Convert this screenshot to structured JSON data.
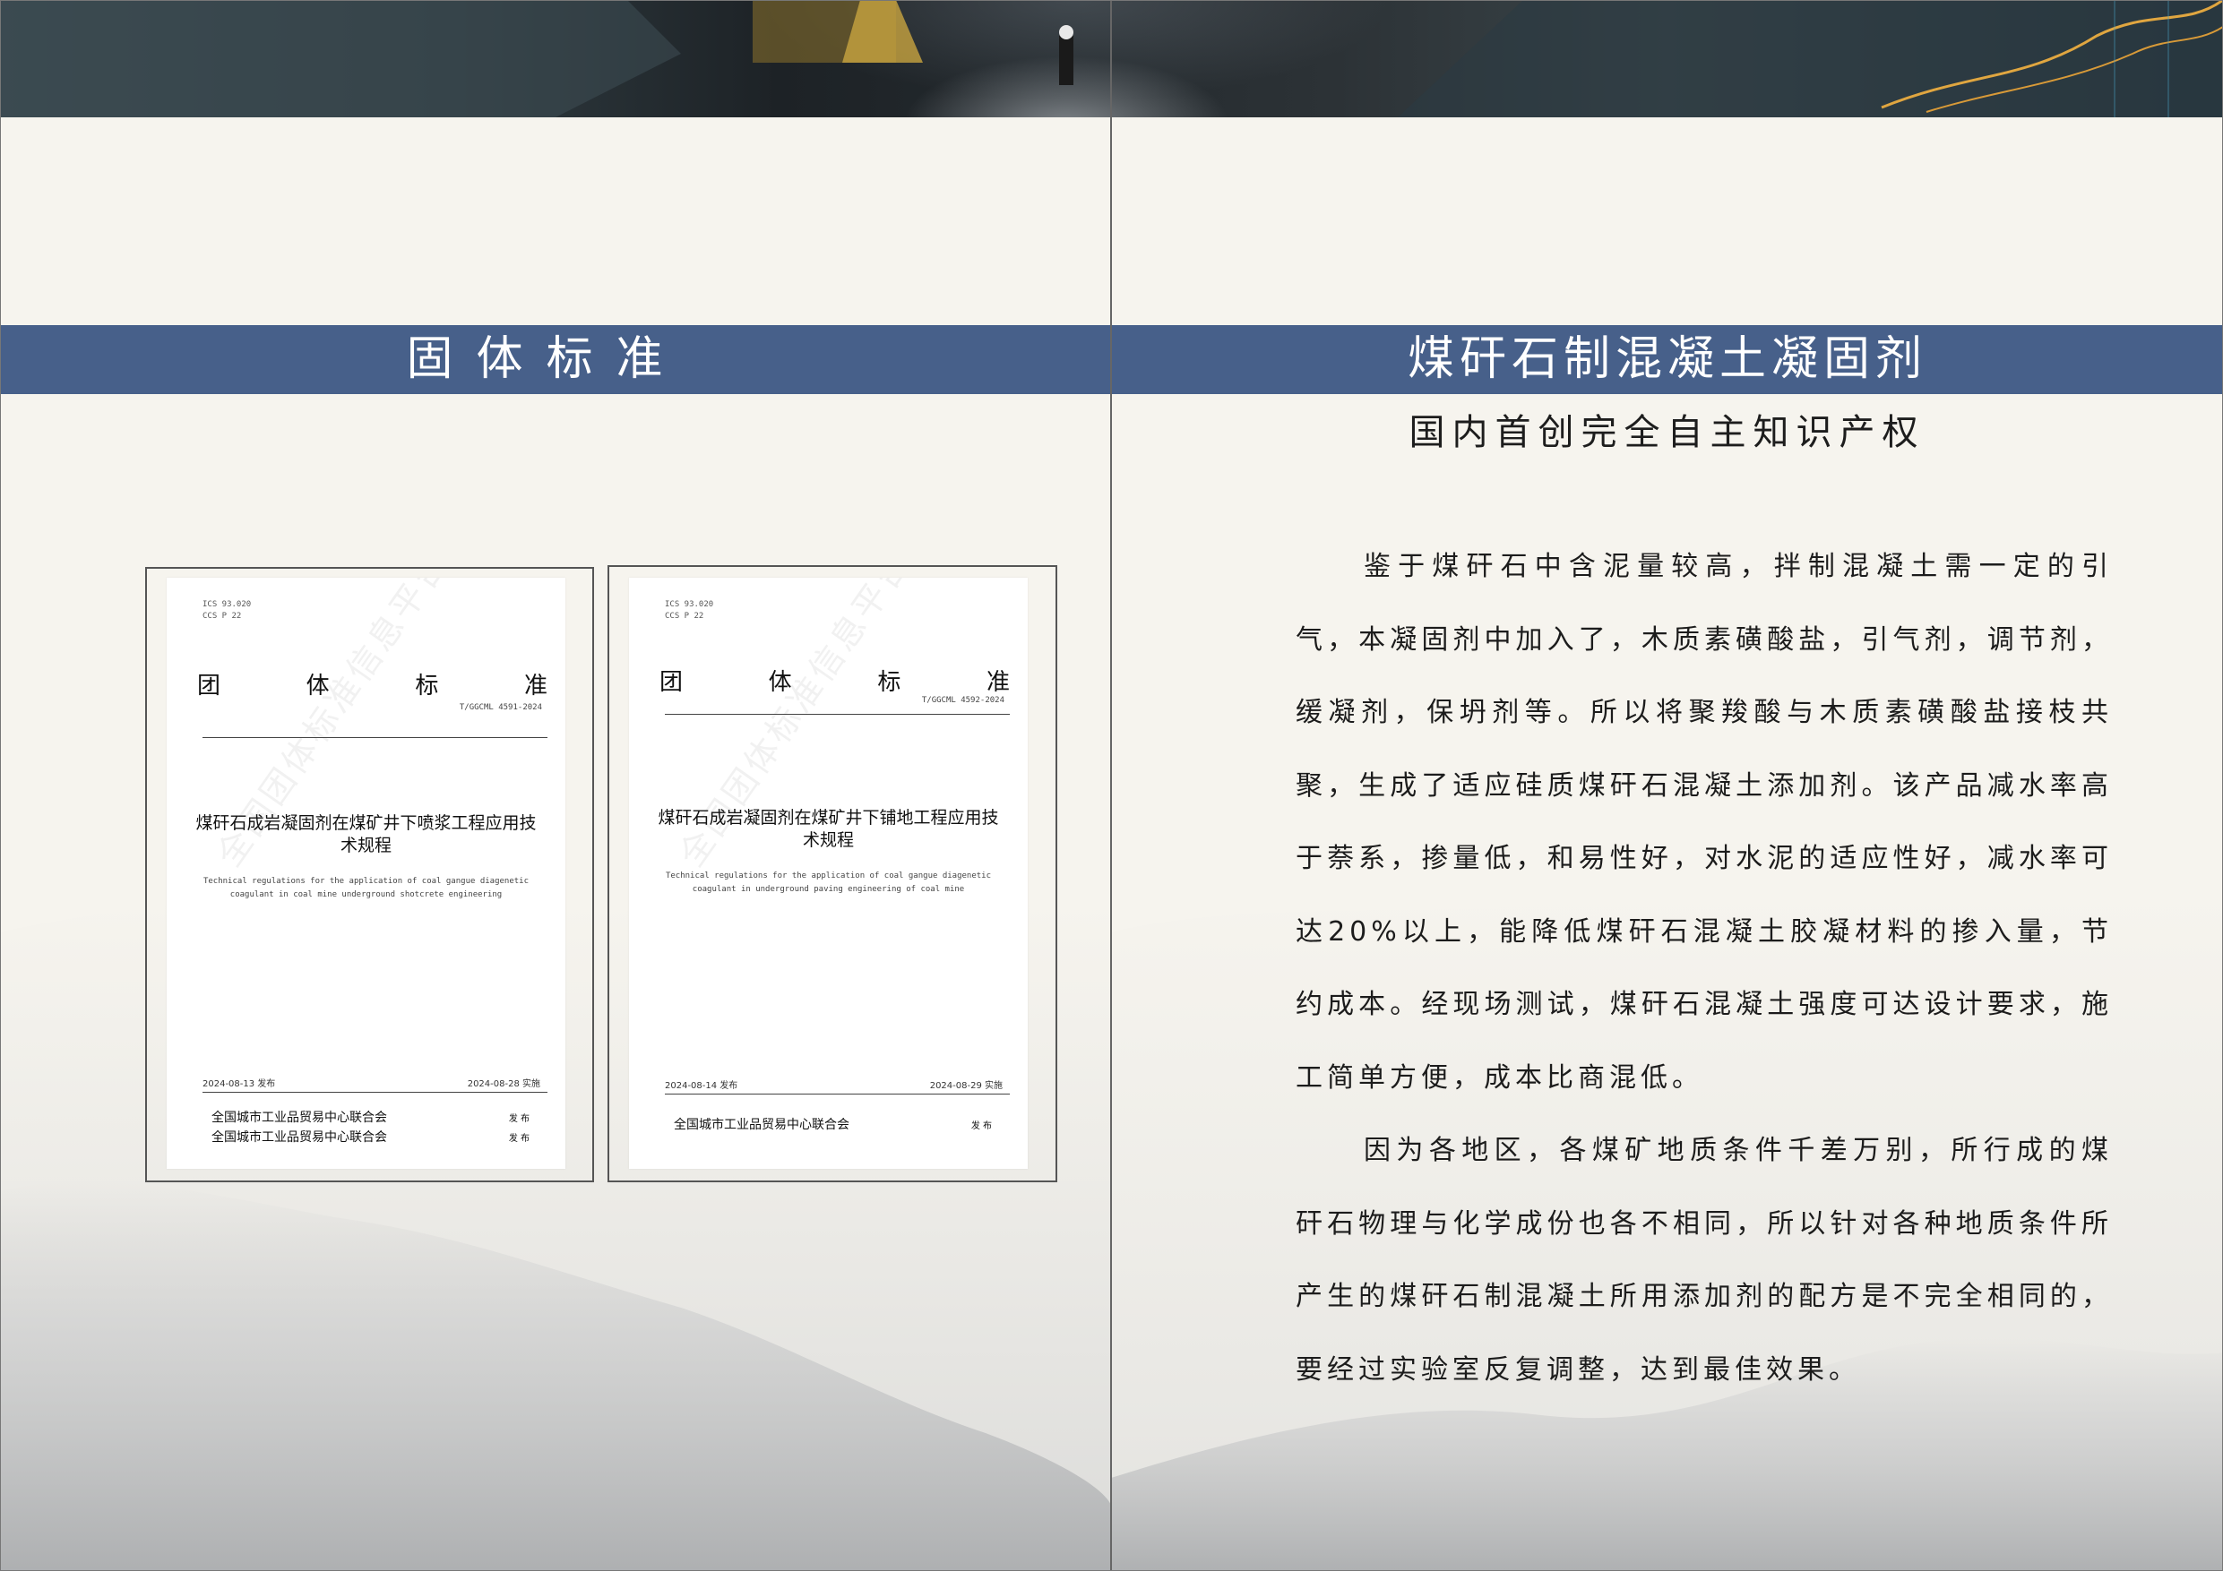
{
  "left_page": {
    "title": "固体标准",
    "certificates": [
      {
        "meta_line1": "ICS 93.020",
        "meta_line2": "CCS P 22",
        "heading_chars": [
          "团",
          "体",
          "标",
          "准"
        ],
        "code": "T/GGCML 4591-2024",
        "title": "煤矸石成岩凝固剂在煤矿井下喷浆工程应用技术规程",
        "english": "Technical regulations for the application of coal gangue diagenetic coagulant in coal mine underground shotcrete engineering",
        "publish_date": "2024-08-13 发布",
        "effective_date": "2024-08-28 实施",
        "watermark": "全国团体标准信息平台",
        "orgs": [
          {
            "name": "全国城市工业品贸易中心联合会",
            "action": "发 布"
          },
          {
            "name": "全国城市工业品贸易中心联合会",
            "action": "发 布"
          }
        ]
      },
      {
        "meta_line1": "ICS 93.020",
        "meta_line2": "CCS P 22",
        "heading_chars": [
          "团",
          "体",
          "标",
          "准"
        ],
        "code": "T/GGCML 4592-2024",
        "title": "煤矸石成岩凝固剂在煤矿井下铺地工程应用技术规程",
        "english": "Technical regulations for the application of coal gangue diagenetic coagulant in underground paving engineering of coal mine",
        "publish_date": "2024-08-14 发布",
        "effective_date": "2024-08-29 实施",
        "watermark": "全国团体标准信息平台",
        "orgs": [
          {
            "name": "全国城市工业品贸易中心联合会",
            "action": "发 布"
          }
        ]
      }
    ]
  },
  "right_page": {
    "title": "煤矸石制混凝土凝固剂",
    "subtitle": "国内首创完全自主知识产权",
    "paragraphs": [
      "鉴于煤矸石中含泥量较高，拌制混凝土需一定的引气，本凝固剂中加入了，木质素磺酸盐，引气剂，调节剂，缓凝剂，保坍剂等。所以将聚羧酸与木质素磺酸盐接枝共聚，生成了适应硅质煤矸石混凝土添加剂。该产品减水率高于萘系，掺量低，和易性好，对水泥的适应性好，减水率可达20%以上，能降低煤矸石混凝土胶凝材料的掺入量，节约成本。经现场测试，煤矸石混凝土强度可达设计要求，施工简单方便，成本比商混低。",
      "因为各地区，各煤矿地质条件千差万别，所行成的煤矸石物理与化学成份也各不相同，所以针对各种地质条件所产生的煤矸石制混凝土所用添加剂的配方是不完全相同的，要经过实验室反复调整，达到最佳效果。"
    ]
  },
  "colors": {
    "title_bar": "#47608a",
    "paper": "#f6f4ee"
  }
}
